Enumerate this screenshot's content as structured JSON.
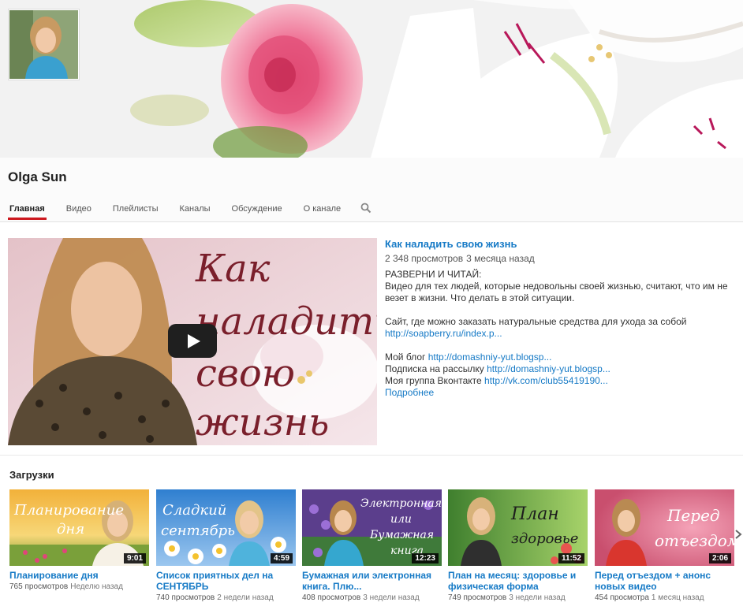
{
  "channel": {
    "name": "Olga Sun",
    "tabs": [
      {
        "label": "Главная",
        "active": true
      },
      {
        "label": "Видео"
      },
      {
        "label": "Плейлисты"
      },
      {
        "label": "Каналы"
      },
      {
        "label": "Обсуждение"
      },
      {
        "label": "О канале"
      }
    ],
    "search_icon": "search-icon"
  },
  "featured": {
    "thumb_text": [
      "Как",
      "наладить",
      "свою",
      "жизнь"
    ],
    "title": "Как наладить свою жизнь",
    "views": "2 348 просмотров",
    "age": "3 месяца назад",
    "desc_heading": "РАЗВЕРНИ И ЧИТАЙ:",
    "desc_text": "Видео для тех людей, которые недовольны своей жизнью, считают, что им не везет в жизни. Что делать в этой ситуации.",
    "site_text": "Сайт, где можно заказать натуральные средства для ухода за собой",
    "site_link": "http://soapberry.ru/index.p...",
    "blog_label": "Мой блог",
    "blog_link": "http://domashniy-yut.blogsp...",
    "subscribe_label": "Подписка на рассылку",
    "subscribe_link": "http://domashniy-yut.blogsp...",
    "group_label": "Моя группа Вконтакте",
    "group_link": "http://vk.com/club55419190...",
    "more": "Подробнее"
  },
  "uploads": {
    "title": "Загрузки",
    "items": [
      {
        "title": "Планирование дня",
        "thumb_text": [
          "Планирование",
          "дня"
        ],
        "duration": "9:01",
        "views": "765 просмотров",
        "age": "Неделю назад"
      },
      {
        "title": "Список приятных дел на СЕНТЯБРЬ",
        "thumb_text": [
          "Сладкий",
          "сентябрь"
        ],
        "duration": "4:59",
        "views": "740 просмотров",
        "age": "2 недели назад"
      },
      {
        "title": "Бумажная или электронная книга. Плю...",
        "thumb_text": [
          "Электронная",
          "или",
          "Бумажная",
          "книга"
        ],
        "duration": "12:23",
        "views": "408 просмотров",
        "age": "3 недели назад"
      },
      {
        "title": "План на месяц: здоровье и физическая форма",
        "thumb_text": [
          "План",
          "здоровье"
        ],
        "duration": "11:52",
        "views": "749 просмотров",
        "age": "3 недели назад"
      },
      {
        "title": "Перед отъездом + анонс новых видео",
        "thumb_text": [
          "Перед",
          "отъездом"
        ],
        "duration": "2:06",
        "views": "454 просмотра",
        "age": "1 месяц назад"
      }
    ]
  },
  "colors": {
    "link": "#167ac6",
    "active_tab": "#cc181e",
    "play_button": "#1f1f1f"
  }
}
